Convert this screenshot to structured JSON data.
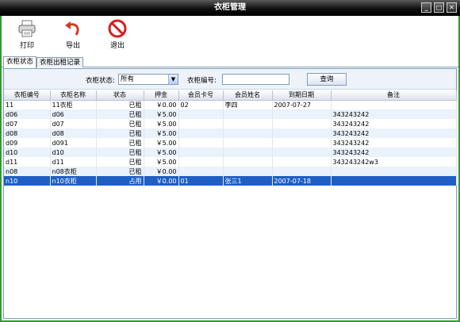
{
  "window": {
    "title": "衣柜管理",
    "min": "_",
    "max": "□",
    "close": "✕"
  },
  "toolbar": {
    "print": {
      "label": "打印",
      "icon": "printer-icon"
    },
    "export": {
      "label": "导出",
      "icon": "undo-arrow-icon"
    },
    "exit": {
      "label": "退出",
      "icon": "no-entry-icon"
    }
  },
  "tabs": [
    "衣柜状态",
    "衣柜出租记录"
  ],
  "filter": {
    "status_label": "衣柜状态:",
    "status_value": "所有",
    "number_label": "衣柜编号:",
    "number_value": "",
    "query_button": "查询"
  },
  "table": {
    "headers": [
      "衣柜编号",
      "衣柜名称",
      "状态",
      "押金",
      "会员卡号",
      "会员姓名",
      "到期日期",
      "备注"
    ],
    "rows": [
      [
        "11",
        "11衣柜",
        "已租",
        "￥0.00",
        "02",
        "李四",
        "2007-07-27",
        ""
      ],
      [
        "d06",
        "d06",
        "已租",
        "￥5.00",
        "",
        "",
        "",
        "343243242"
      ],
      [
        "d07",
        "d07",
        "已租",
        "￥5.00",
        "",
        "",
        "",
        "343243242"
      ],
      [
        "d08",
        "d08",
        "已租",
        "￥5.00",
        "",
        "",
        "",
        "343243242"
      ],
      [
        "d09",
        "d091",
        "已租",
        "￥5.00",
        "",
        "",
        "",
        "343243242"
      ],
      [
        "d10",
        "d10",
        "已租",
        "￥5.00",
        "",
        "",
        "",
        "343243242"
      ],
      [
        "d11",
        "d11",
        "已租",
        "￥5.00",
        "",
        "",
        "",
        "343243242w3"
      ],
      [
        "n08",
        "n08衣柜",
        "已租",
        "￥0.00",
        "",
        "",
        "",
        ""
      ],
      [
        "n10",
        "n10衣柜",
        "占用",
        "￥0.00",
        "01",
        "张三1",
        "2007-07-18",
        ""
      ]
    ],
    "selected_row": 8
  }
}
